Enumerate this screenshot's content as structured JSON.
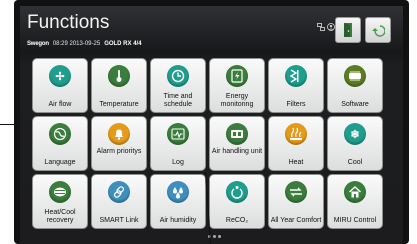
{
  "header": {
    "title": "Functions",
    "brand": "Swegon",
    "datetime": "08:29 2013-09-25",
    "model": "GOLD RX  4/4"
  },
  "colors": {
    "screen_bg": "#1c1c1e",
    "tile_bg": "#f2f2f2"
  },
  "toolbar": {
    "status_icons": [
      "network-icon",
      "user-icon"
    ],
    "buttons": [
      "door-exit-icon",
      "back-arrow-icon"
    ]
  },
  "tiles": [
    {
      "label": "Air flow",
      "icon": "fan-icon",
      "color": "#1f9e8e"
    },
    {
      "label": "Temperature",
      "icon": "thermometer-icon",
      "color": "#3a7d3c"
    },
    {
      "label": "Time and schedule",
      "icon": "clock-icon",
      "color": "#1f9e8e"
    },
    {
      "label": "Energy monitoring",
      "icon": "energy-icon",
      "color": "#3a7d3c"
    },
    {
      "label": "Filters",
      "icon": "filter-icon",
      "color": "#1f9e8e"
    },
    {
      "label": "Software",
      "icon": "software-icon",
      "color": "#5b7d22"
    },
    {
      "label": "Language",
      "icon": "globe-icon",
      "color": "#3a7d3c"
    },
    {
      "label": "Alarm prioritys",
      "icon": "bell-icon",
      "color": "#e59a1a"
    },
    {
      "label": "Log",
      "icon": "log-icon",
      "color": "#3a7d3c"
    },
    {
      "label": "Air handling unit",
      "icon": "ahu-icon",
      "color": "#3a7d3c"
    },
    {
      "label": "Heat",
      "icon": "heat-icon",
      "color": "#e59a1a"
    },
    {
      "label": "Cool",
      "icon": "snowflake-icon",
      "color": "#1f9e8e"
    },
    {
      "label": "Heat/Cool recovery",
      "icon": "recovery-icon",
      "color": "#3a7d3c"
    },
    {
      "label": "SMART Link",
      "icon": "link-icon",
      "color": "#3f8fbd"
    },
    {
      "label": "Air humidity",
      "icon": "droplets-icon",
      "color": "#3f8fbd"
    },
    {
      "label": "ReCO₂",
      "icon": "reco2-icon",
      "color": "#1f9e8e"
    },
    {
      "label": "All Year Comfort",
      "icon": "comfort-icon",
      "color": "#3a7d3c"
    },
    {
      "label": "MIRU Control",
      "icon": "house-icon",
      "color": "#3a7d3c"
    }
  ]
}
